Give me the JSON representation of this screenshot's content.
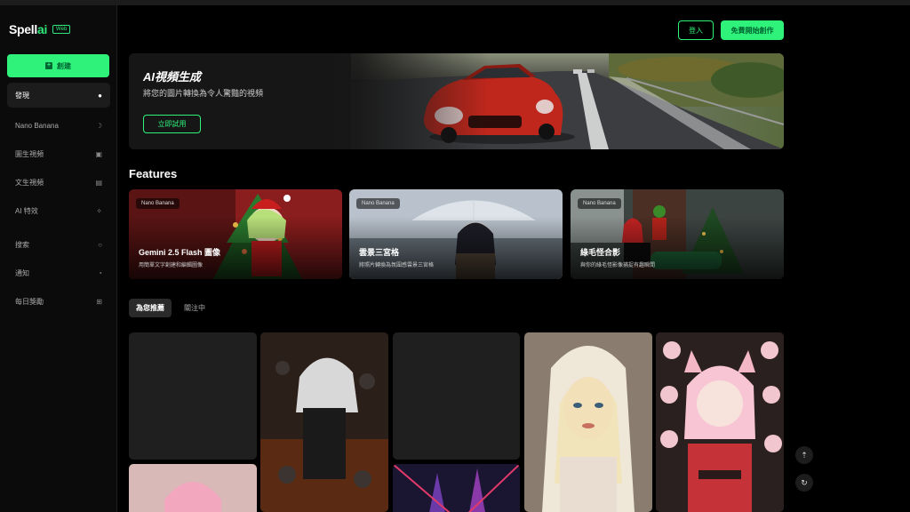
{
  "brand": {
    "name_main": "Spell",
    "name_accent": "ai",
    "badge": "Web"
  },
  "sidebar": {
    "create_label": "創建",
    "items": [
      {
        "label": "發現",
        "icon": "compass-icon",
        "glyph": "✪"
      },
      {
        "label": "Nano Banana",
        "icon": "banana-icon",
        "glyph": "⌕"
      },
      {
        "label": "圖生視頻",
        "icon": "image-video-icon",
        "glyph": "▣"
      },
      {
        "label": "文生視頻",
        "icon": "text-video-icon",
        "glyph": "▤"
      },
      {
        "label": "AI 特效",
        "icon": "sparkle-icon",
        "glyph": "✧"
      },
      {
        "label": "搜索",
        "icon": "search-icon",
        "glyph": "⌕"
      },
      {
        "label": "通知",
        "icon": "bell-icon",
        "glyph": "◔"
      },
      {
        "label": "每日獎勵",
        "icon": "gift-icon",
        "glyph": "⊞"
      }
    ]
  },
  "header": {
    "login_label": "登入",
    "start_label": "免費開始創作"
  },
  "banner": {
    "title": "AI視頻生成",
    "subtitle": "將您的圖片轉換為令人驚豔的視頻",
    "cta": "立即試用"
  },
  "features": {
    "title": "Features",
    "cards": [
      {
        "tag": "Nano Banana",
        "title": "Gemini 2.5 Flash 圖像",
        "subtitle": "用簡單文字創建和編輯圖像"
      },
      {
        "tag": "Nano Banana",
        "title": "雲景三宮格",
        "subtitle": "將照片轉換為氛圍感雲景三宮格"
      },
      {
        "tag": "Nano Banana",
        "title": "綠毛怪合影",
        "subtitle": "與你的綠毛怪影像捕捉有趣瞬間"
      }
    ]
  },
  "tabs": [
    {
      "label": "為您推薦"
    },
    {
      "label": "關注中"
    }
  ],
  "colors": {
    "accent": "#2ef27a",
    "background": "#000000",
    "sidebar": "#0b0b0b"
  }
}
